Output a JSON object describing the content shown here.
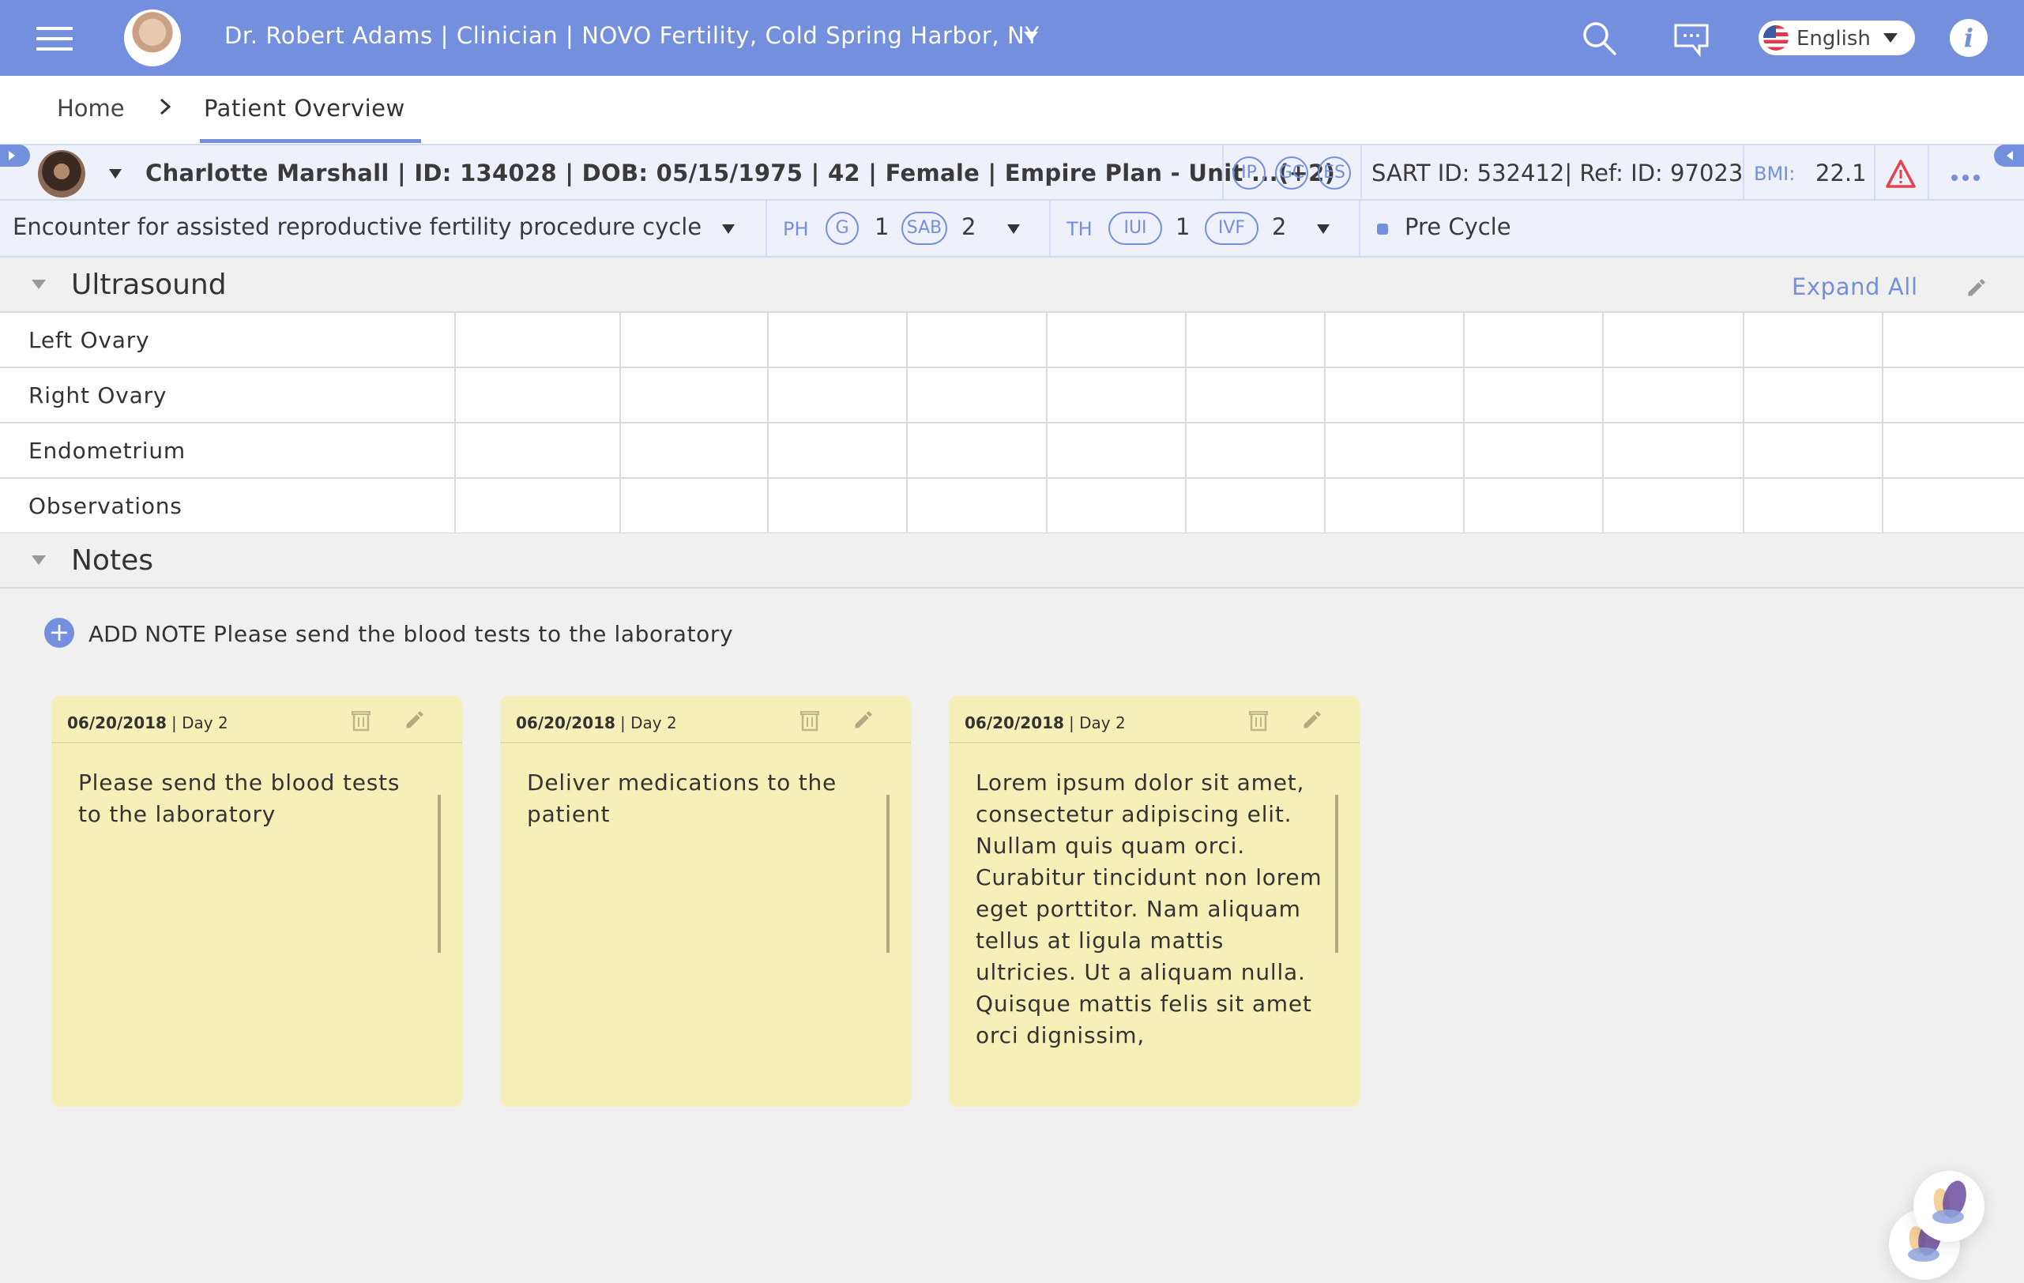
{
  "header": {
    "title": "Dr. Robert Adams | Clinician | NOVO Fertility, Cold Spring Harbor, NY",
    "language": "English",
    "icons": [
      "menu-icon",
      "search-icon",
      "chat-icon",
      "flag-us-icon",
      "info-icon"
    ],
    "colors": {
      "brand": "#738fdd"
    }
  },
  "breadcrumb": {
    "items": [
      {
        "label": "Home"
      },
      {
        "label": "Patient Overview"
      }
    ]
  },
  "patient": {
    "summary": "Charlotte Marshall | ID: 134028 | DOB: 05/15/1975 | 42 | Female | Empire Plan - Unit ...(+2)",
    "badges": [
      "IP",
      "GC",
      "ES"
    ],
    "sart": "SART ID: 532412| Ref: ID: 97023",
    "bmi_label": "BMI:",
    "bmi_value": "22.1",
    "alert_color": "#e0454f"
  },
  "encounter": {
    "label": "Encounter for assisted reproductive fertility procedure cycle",
    "ph": {
      "label": "PH",
      "items": [
        {
          "chip": "G",
          "count": "1"
        },
        {
          "chip": "SAB",
          "count": "2"
        }
      ]
    },
    "th": {
      "label": "TH",
      "items": [
        {
          "chip": "IUI",
          "count": "1"
        },
        {
          "chip": "IVF",
          "count": "2"
        }
      ]
    },
    "status": "Pre Cycle"
  },
  "ultrasound": {
    "title": "Ultrasound",
    "expand_all": "Expand All",
    "rows": [
      {
        "label": "Left Ovary"
      },
      {
        "label": "Right Ovary"
      },
      {
        "label": "Endometrium"
      },
      {
        "label": "Observations"
      }
    ]
  },
  "notes": {
    "title": "Notes",
    "add_label": "ADD NOTE",
    "input_value": "Please send the blood tests to the laboratory",
    "cards": [
      {
        "date": "06/20/2018",
        "day": "| Day 2",
        "text": "Please send the blood tests to the laboratory"
      },
      {
        "date": "06/20/2018",
        "day": "| Day 2",
        "text": "Deliver medications to the patient"
      },
      {
        "date": "06/20/2018",
        "day": "| Day 2",
        "text": "Lorem ipsum dolor sit amet, consectetur adipiscing elit. Nullam quis quam orci. Curabitur tincidunt non lorem eget porttitor. Nam aliquam tellus at ligula mattis ultricies. Ut a aliquam nulla. Quisque mattis felis sit amet orci dignissim,"
      }
    ],
    "card_color": "#f5f0b7"
  }
}
